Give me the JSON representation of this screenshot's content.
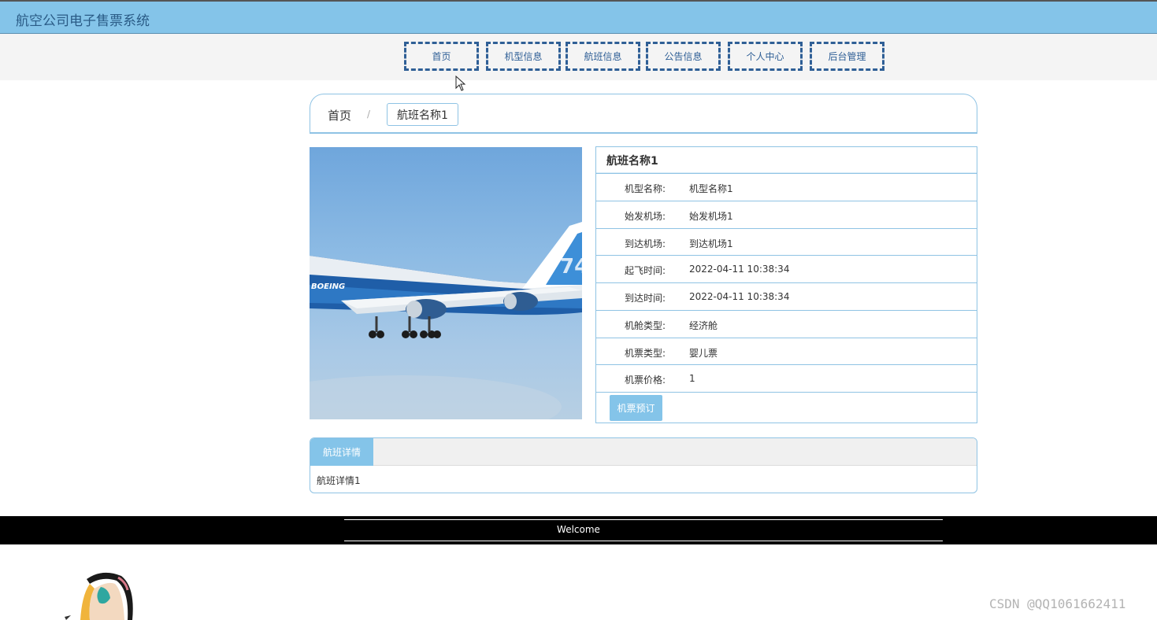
{
  "app": {
    "title": "航空公司电子售票系统"
  },
  "nav": {
    "items": [
      {
        "label": "首页"
      },
      {
        "label": "机型信息"
      },
      {
        "label": "航班信息"
      },
      {
        "label": "公告信息"
      },
      {
        "label": "个人中心"
      },
      {
        "label": "后台管理"
      }
    ]
  },
  "breadcrumb": {
    "home": "首页",
    "separator": "/",
    "current": "航班名称1"
  },
  "flight": {
    "name": "航班名称1",
    "fields": [
      {
        "label": "机型名称:",
        "value": "机型名称1"
      },
      {
        "label": "始发机场:",
        "value": "始发机场1"
      },
      {
        "label": "到达机场:",
        "value": "到达机场1"
      },
      {
        "label": "起飞时间:",
        "value": "2022-04-11 10:38:34"
      },
      {
        "label": "到达时间:",
        "value": "2022-04-11 10:38:34"
      },
      {
        "label": "机舱类型:",
        "value": "经济舱"
      },
      {
        "label": "机票类型:",
        "value": "婴儿票"
      },
      {
        "label": "机票价格:",
        "value": "1"
      }
    ],
    "book_button": "机票预订"
  },
  "detail": {
    "tab_label": "航班详情",
    "content": "航班详情1"
  },
  "footer": {
    "welcome": "Welcome"
  },
  "watermark": "CSDN @QQ1061662411",
  "colors": {
    "accent": "#84c4e9",
    "nav_border": "#2f5f96",
    "footer_bg": "#000000"
  },
  "photo": {
    "text": "BOEING"
  }
}
